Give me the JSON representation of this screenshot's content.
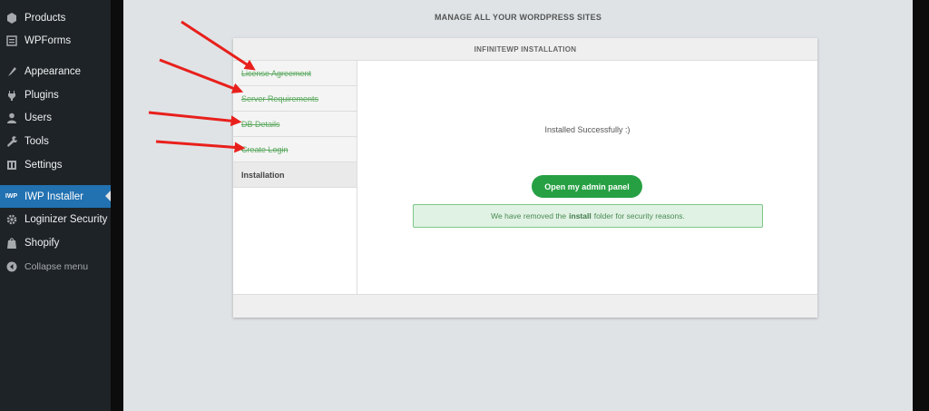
{
  "sidebar": {
    "items": [
      {
        "label": "Products",
        "icon": "products-icon"
      },
      {
        "label": "WPForms",
        "icon": "wpforms-icon"
      },
      {
        "label": "Appearance",
        "icon": "appearance-icon"
      },
      {
        "label": "Plugins",
        "icon": "plugins-icon"
      },
      {
        "label": "Users",
        "icon": "users-icon"
      },
      {
        "label": "Tools",
        "icon": "tools-icon"
      },
      {
        "label": "Settings",
        "icon": "settings-icon"
      },
      {
        "label": "IWP Installer",
        "icon": "iwp-icon",
        "icon_text": "IWP",
        "active": true
      },
      {
        "label": "Loginizer Security",
        "icon": "gear-icon"
      },
      {
        "label": "Shopify",
        "icon": "shopify-bag-icon"
      }
    ],
    "collapse_label": "Collapse menu"
  },
  "main": {
    "heading": "MANAGE ALL YOUR WORDPRESS SITES",
    "panel_title": "INFINITEWP INSTALLATION",
    "steps": [
      {
        "label": "License Agreement",
        "done": true
      },
      {
        "label": "Server Requirements",
        "done": true
      },
      {
        "label": "DB Details",
        "done": true
      },
      {
        "label": "Create Login",
        "done": true
      },
      {
        "label": "Installation",
        "done": false
      }
    ],
    "success_message": "Installed Successfully :)",
    "admin_button": "Open my admin panel",
    "notice_prefix": "We have removed the",
    "notice_bold": "install",
    "notice_suffix": "folder for security reasons."
  },
  "colors": {
    "sidebar_bg": "#1d2327",
    "active_item": "#2271b1",
    "content_bg": "#dfe3e6",
    "button_green": "#26a043",
    "step_done_text": "#5aa85e",
    "arrow_red": "#e8201c"
  }
}
